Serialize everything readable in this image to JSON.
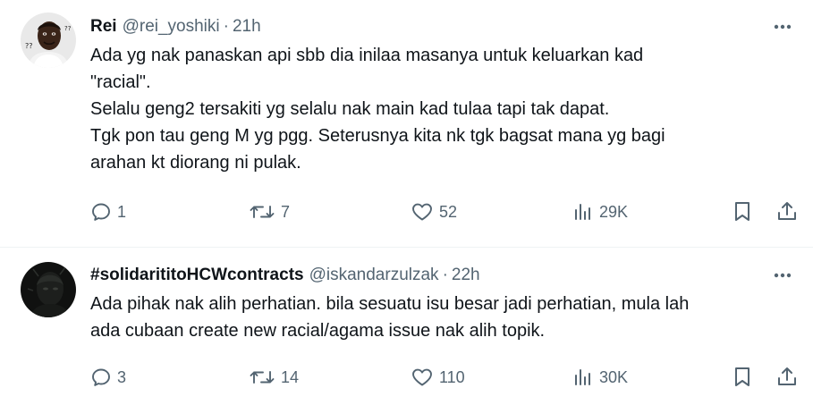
{
  "tweets": [
    {
      "display_name": "Rei",
      "handle": "@rei_yoshiki",
      "separator": "·",
      "time": "21h",
      "body_lines": [
        "Ada yg nak panaskan api sbb dia inilaa masanya untuk keluarkan kad",
        "\"racial\".",
        "Selalu geng2 tersakiti yg selalu nak main kad tulaa tapi tak dapat.",
        "Tgk pon tau geng M yg pgg. Seterusnya kita nk tgk bagsat mana yg bagi",
        "arahan kt diorang ni pulak."
      ],
      "replies": "1",
      "retweets": "7",
      "likes": "52",
      "views": "29K",
      "avatar_icon": "meme-avatar"
    },
    {
      "display_name": "#solidarititoHCWcontracts",
      "handle": "@iskandarzulzak",
      "separator": "·",
      "time": "22h",
      "body_lines": [
        "Ada pihak nak alih perhatian. bila sesuatu isu besar jadi perhatian, mula lah",
        "ada cubaan create new racial/agama issue nak alih topik."
      ],
      "replies": "3",
      "retweets": "14",
      "likes": "110",
      "views": "30K",
      "avatar_icon": "dark-avatar"
    }
  ],
  "icons": [
    "more-icon",
    "reply-icon",
    "retweet-icon",
    "like-icon",
    "views-icon",
    "bookmark-icon",
    "share-icon"
  ],
  "colors": {
    "text": "#0f1419",
    "muted": "#536471",
    "divider": "#eff3f4"
  }
}
